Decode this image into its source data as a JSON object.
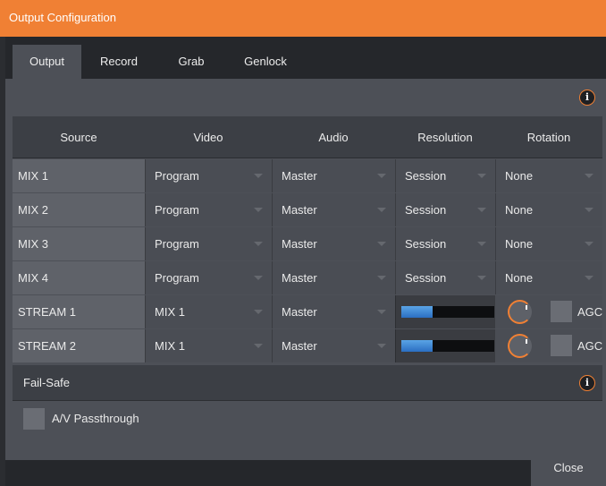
{
  "window": {
    "title": "Output Configuration"
  },
  "tabs": [
    {
      "label": "Output",
      "active": true
    },
    {
      "label": "Record"
    },
    {
      "label": "Grab"
    },
    {
      "label": "Genlock"
    }
  ],
  "table": {
    "headers": [
      "Source",
      "Video",
      "Audio",
      "Resolution",
      "Rotation"
    ],
    "rows": [
      {
        "source": "MIX 1",
        "video": "Program",
        "audio": "Master",
        "resolution": "Session",
        "rotation": "None"
      },
      {
        "source": "MIX 2",
        "video": "Program",
        "audio": "Master",
        "resolution": "Session",
        "rotation": "None"
      },
      {
        "source": "MIX 3",
        "video": "Program",
        "audio": "Master",
        "resolution": "Session",
        "rotation": "None"
      },
      {
        "source": "MIX 4",
        "video": "Program",
        "audio": "Master",
        "resolution": "Session",
        "rotation": "None"
      },
      {
        "source": "STREAM 1",
        "video": "MIX 1",
        "audio": "Master",
        "meter_level": 0.34,
        "agc_label": "AGC",
        "agc_checked": false
      },
      {
        "source": "STREAM 2",
        "video": "MIX 1",
        "audio": "Master",
        "meter_level": 0.34,
        "agc_label": "AGC",
        "agc_checked": false
      }
    ]
  },
  "failsafe": {
    "title": "Fail-Safe",
    "passthrough_label": "A/V Passthrough",
    "passthrough_checked": false
  },
  "footer": {
    "close_label": "Close"
  },
  "icons": {
    "info": "info-icon",
    "dropdown": "chevron-down-icon"
  },
  "colors": {
    "accent": "#f08034",
    "meter": "#3a86d8"
  }
}
